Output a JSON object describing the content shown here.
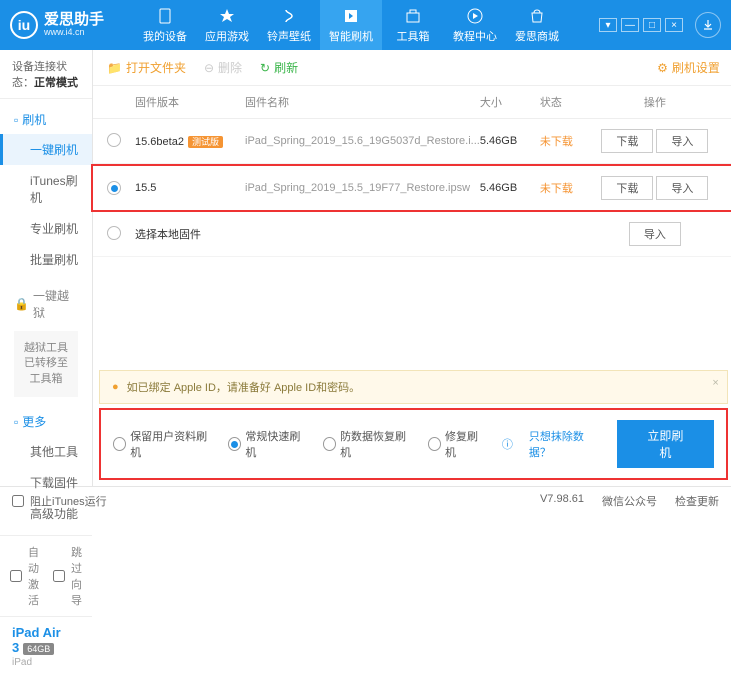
{
  "app": {
    "name": "爱思助手",
    "url": "www.i4.cn"
  },
  "nav": [
    {
      "id": "device",
      "label": "我的设备"
    },
    {
      "id": "apps",
      "label": "应用游戏"
    },
    {
      "id": "ring",
      "label": "铃声壁纸"
    },
    {
      "id": "flash",
      "label": "智能刷机"
    },
    {
      "id": "toolbox",
      "label": "工具箱"
    },
    {
      "id": "tutorial",
      "label": "教程中心"
    },
    {
      "id": "store",
      "label": "爱思商城"
    }
  ],
  "conn": {
    "label": "设备连接状态：",
    "value": "正常模式"
  },
  "side": {
    "flash": {
      "title": "刷机",
      "items": [
        "一键刷机",
        "iTunes刷机",
        "专业刷机",
        "批量刷机"
      ]
    },
    "jailbreak": {
      "title": "一键越狱",
      "notice": "越狱工具已转移至\n工具箱"
    },
    "more": {
      "title": "更多",
      "items": [
        "其他工具",
        "下载固件",
        "高级功能"
      ]
    }
  },
  "checks": {
    "autoActivate": "自动激活",
    "skipGuide": "跳过向导"
  },
  "device": {
    "name": "iPad Air 3",
    "storage": "64GB",
    "type": "iPad"
  },
  "toolbar": {
    "open": "打开文件夹",
    "delete": "删除",
    "refresh": "刷新",
    "settings": "刷机设置"
  },
  "cols": {
    "ver": "固件版本",
    "name": "固件名称",
    "size": "大小",
    "status": "状态",
    "ops": "操作"
  },
  "rows": [
    {
      "sel": false,
      "ver": "15.6beta2",
      "beta": "测试版",
      "name": "iPad_Spring_2019_15.6_19G5037d_Restore.i...",
      "size": "5.46GB",
      "status": "未下载"
    },
    {
      "sel": true,
      "ver": "15.5",
      "name": "iPad_Spring_2019_15.5_19F77_Restore.ipsw",
      "size": "5.46GB",
      "status": "未下载"
    }
  ],
  "localfw": "选择本地固件",
  "btns": {
    "download": "下载",
    "import": "导入"
  },
  "warn": "如已绑定 Apple ID，请准备好 Apple ID和密码。",
  "opts": {
    "keep": "保留用户资料刷机",
    "normal": "常规快速刷机",
    "antirecovery": "防数据恢复刷机",
    "repair": "修复刷机",
    "delq": "只想抹除数据？",
    "go": "立即刷机"
  },
  "status": {
    "block": "阻止iTunes运行",
    "ver": "V7.98.61",
    "wechat": "微信公众号",
    "check": "检查更新"
  }
}
